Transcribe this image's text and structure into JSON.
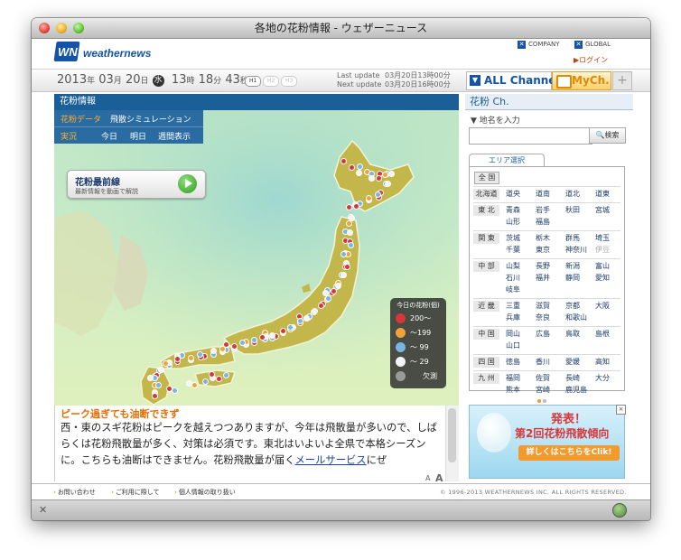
{
  "window": {
    "title": "各地の花粉情報 - ウェザーニュース"
  },
  "header": {
    "logo_text": "weathernews",
    "logo_mark": "WN",
    "company_link": "COMPANY",
    "global_link": "GLOBAL",
    "login": "▶ログイン"
  },
  "datebar": {
    "year": "2013",
    "year_unit": "年",
    "month": "03",
    "month_unit": "月",
    "day": "20",
    "day_unit": "日",
    "weekday": "水",
    "hour": "13",
    "hour_unit": "時",
    "minute": "18",
    "minute_unit": "分",
    "second": "43",
    "second_unit": "秒",
    "h1": "H1",
    "h2": "H2",
    "h3": "H3",
    "last_update_label": "Last update",
    "last_update_value": "03月20日13時00分",
    "next_update_label": "Next update",
    "next_update_value": "03月20日16時00分",
    "all_channel": "ALL Channel",
    "mych": "MyCh.",
    "plus": "+"
  },
  "main": {
    "section_title": "花粉情報",
    "menu": {
      "pollen_data": "花粉データ",
      "simulation": "飛散シミュレーション",
      "actual": "実況",
      "today": "今日",
      "tomorrow": "明日",
      "weekly": "週間表示"
    },
    "video_button": {
      "title": "花粉最前線",
      "subtitle": "最新情報を動画で解説"
    },
    "legend": {
      "title": "今日の花粉(個)",
      "items": [
        {
          "label": "200〜",
          "color": "#d8363a"
        },
        {
          "label": "〜199",
          "color": "#f2a23a"
        },
        {
          "label": "〜 99",
          "color": "#7ab4e3"
        },
        {
          "label": "〜 29",
          "color": "#f4f4f4"
        },
        {
          "label": "欠測",
          "color": "#9a9a9a"
        }
      ]
    },
    "news": {
      "headline": "ピーク過ぎても油断できず",
      "body": "西・東のスギ花粉はピークを越えつつありますが、今年は飛散量が多いので、しばらくは花粉飛散量が多く、対策は必須です。東北はいよいよ全県で本格シーズンに。こちらも油断はできません。花粉飛散量が届く",
      "link": "メールサービス",
      "tail": "にぜ"
    },
    "font_small": "A",
    "font_large": "A"
  },
  "sidebar": {
    "title": "花粉 Ch.",
    "search_label": "▼ 地名を入力",
    "search_placeholder": "",
    "search_button": "検索",
    "area_tab": "エリア選択",
    "all_button": "全 国",
    "regions": [
      {
        "name": "北海道",
        "prefs": [
          [
            "道央",
            "道南",
            "道北",
            "道東"
          ]
        ]
      },
      {
        "name": "東 北",
        "prefs": [
          [
            "青森",
            "岩手",
            "秋田",
            "宮城"
          ],
          [
            "山形",
            "福島"
          ]
        ]
      },
      {
        "name": "関 東",
        "prefs": [
          [
            "茨城",
            "栃木",
            "群馬",
            "埼玉"
          ],
          [
            "千葉",
            "東京",
            "神奈川",
            "伊豆"
          ]
        ]
      },
      {
        "name": "中 部",
        "prefs": [
          [
            "山梨",
            "長野",
            "新潟",
            "富山"
          ],
          [
            "石川",
            "福井",
            "静岡",
            "愛知"
          ],
          [
            "岐阜"
          ]
        ]
      },
      {
        "name": "近 畿",
        "prefs": [
          [
            "三重",
            "滋賀",
            "京都",
            "大阪"
          ],
          [
            "兵庫",
            "奈良",
            "和歌山"
          ]
        ]
      },
      {
        "name": "中 国",
        "prefs": [
          [
            "岡山",
            "広島",
            "鳥取",
            "島根"
          ],
          [
            "山口"
          ]
        ]
      },
      {
        "name": "四 国",
        "prefs": [
          [
            "徳島",
            "香川",
            "愛媛",
            "高知"
          ]
        ]
      },
      {
        "name": "九 州",
        "prefs": [
          [
            "福岡",
            "佐賀",
            "長崎",
            "大分"
          ],
          [
            "熊本",
            "宮崎",
            "鹿児島"
          ]
        ]
      }
    ],
    "banner": {
      "title1": "発表！",
      "title2": "第2回花粉飛散傾向",
      "cta": "詳しくはこちらをClik!"
    }
  },
  "footer": {
    "contact": "お問い合わせ",
    "terms": "ご利用に際して",
    "privacy": "個人情報の取り扱い",
    "copyright": "© 1996-2013 WEATHERNEWS INC. ALL RIGHTS RESERVED."
  },
  "colors": {
    "brand": "#1553a8",
    "accent": "#e66c00",
    "menu": "#2a6ca2"
  }
}
